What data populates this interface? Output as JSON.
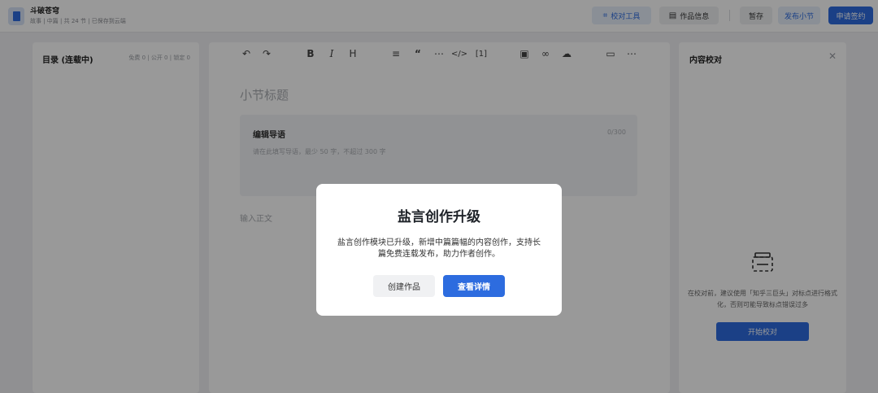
{
  "header": {
    "work_title": "斗破苍穹",
    "work_meta": "故事 | 中篇 | 共 24 节 | 已保存到云端",
    "buttons": {
      "proofread_tool": "校对工具",
      "work_info": "作品信息",
      "save": "暂存",
      "publish": "发布小节",
      "sign": "申请签约"
    }
  },
  "left_panel": {
    "title": "目录 (连载中)",
    "stats": "免费 0 | 公开 0 | 锁定 0"
  },
  "editor": {
    "toolbar": [
      "undo-icon",
      "redo-icon",
      "bold-icon",
      "italic-icon",
      "heading-icon",
      "align-icon",
      "quote-icon",
      "divider-icon",
      "code-icon",
      "formula-icon",
      "image-icon",
      "link-icon",
      "cloud-icon",
      "folder-icon",
      "more-icon"
    ],
    "section_title_placeholder": "小节标题",
    "guide": {
      "title": "编辑导语",
      "count": "0/300",
      "placeholder": "请在此填写导语，最少 50 字，不超过 300 字"
    },
    "body_placeholder": "输入正文"
  },
  "right_panel": {
    "title": "内容校对",
    "description": "在校对前，建议使用「知乎三巨头」对标点进行格式化，否则可能导致标点错误过多",
    "start_button": "开始校对"
  },
  "modal": {
    "title": "盐言创作升级",
    "text": "盐言创作模块已升级，新增中篇篇幅的内容创作，支持长篇免费连载发布，助力作者创作。",
    "create_button": "创建作品",
    "details_button": "查看详情"
  },
  "colors": {
    "accent": "#2d6cdf",
    "overlay": "rgba(0,0,0,0.40)"
  }
}
